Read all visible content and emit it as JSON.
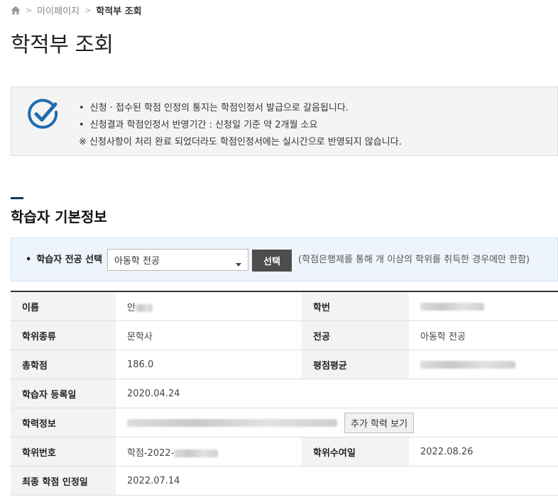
{
  "breadcrumb": {
    "home_icon": "home-icon",
    "items": [
      "마이페이지",
      "학적부 조회"
    ]
  },
  "page": {
    "title": "학적부 조회"
  },
  "notice": {
    "icon": "check-circle-icon",
    "lines": [
      "신청 · 접수된 학점 인정의 통지는 학점인정서 발급으로 갈음됩니다.",
      "신청결과 학점인정서 반영기간 : 신청일 기준 약 2개월 소요",
      "※ 신청사항이 처리 완료 되었더라도 학점인정서에는 실시간으로 반영되지 않습니다."
    ]
  },
  "section": {
    "title": "학습자 기본정보"
  },
  "major_select": {
    "label": "학습자 전공 선택",
    "value": "아동학 전공",
    "button_label": "선택",
    "note": "(학점은행제를 통해    개 이상의 학위를 취득한 경우에만 한함)"
  },
  "table": {
    "name_label": "이름",
    "name_value": "안",
    "student_id_label": "학번",
    "degree_type_label": "학위종류",
    "degree_type_value": "문학사",
    "major_label": "전공",
    "major_value": "아동학 전공",
    "total_credits_label": "총학점",
    "total_credits_value": "186.0",
    "gpa_label": "평점평균",
    "registration_date_label": "학습자 등록일",
    "registration_date_value": "2020.04.24",
    "education_label": "학력정보",
    "more_education_button": "추가 학력 보기",
    "degree_number_label": "학위번호",
    "degree_number_value": "학점-2022-",
    "degree_date_label": "학위수여일",
    "degree_date_value": "2022.08.26",
    "final_credit_date_label": "최종 학점 인정일",
    "final_credit_date_value": "2022.07.14"
  },
  "colors": {
    "accent_navy": "#17365d",
    "check_icon_blue": "#1f6bb0",
    "select_button_bg": "#4d4d4d",
    "header_cell_bg": "#f3f3f3",
    "select_box_bg": "#eef4fb"
  }
}
